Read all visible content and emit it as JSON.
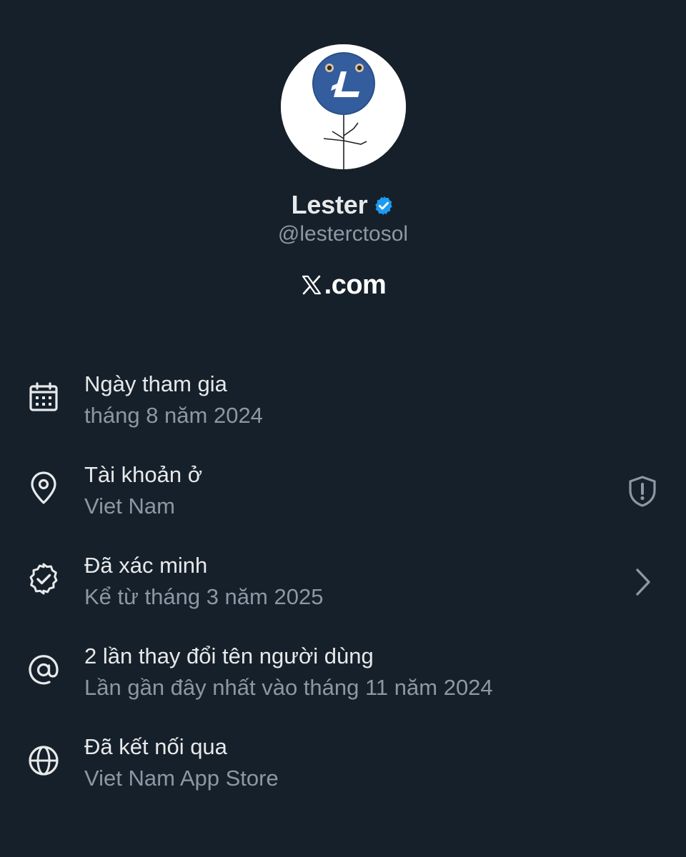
{
  "profile": {
    "display_name": "Lester",
    "handle": "@lesterctosol",
    "verified": true,
    "badge_color": "#1d9bf0",
    "avatar_icon": "litecoin-stickfigure-avatar",
    "avatar_color": "#345d9d"
  },
  "brand": {
    "logo_icon": "x-logo-icon",
    "text": ".com"
  },
  "info": [
    {
      "icon": "calendar-icon",
      "title": "Ngày tham gia",
      "subtitle": "tháng 8 năm 2024"
    },
    {
      "icon": "location-pin-icon",
      "title": "Tài khoản ở",
      "subtitle": "Viet Nam",
      "trailing_icon": "shield-alert-icon"
    },
    {
      "icon": "verified-outline-icon",
      "title": "Đã xác minh",
      "subtitle": "Kể từ tháng 3 năm 2025",
      "trailing_icon": "chevron-right-icon"
    },
    {
      "icon": "at-sign-icon",
      "title": "2 lần thay đổi tên người dùng",
      "subtitle": "Lần gần đây nhất vào tháng 11 năm 2024"
    },
    {
      "icon": "globe-icon",
      "title": "Đã kết nối qua",
      "subtitle": "Viet Nam App Store"
    }
  ],
  "colors": {
    "background": "#16202a",
    "primary_text": "#e7e9ea",
    "secondary_text": "#8b98a5"
  }
}
